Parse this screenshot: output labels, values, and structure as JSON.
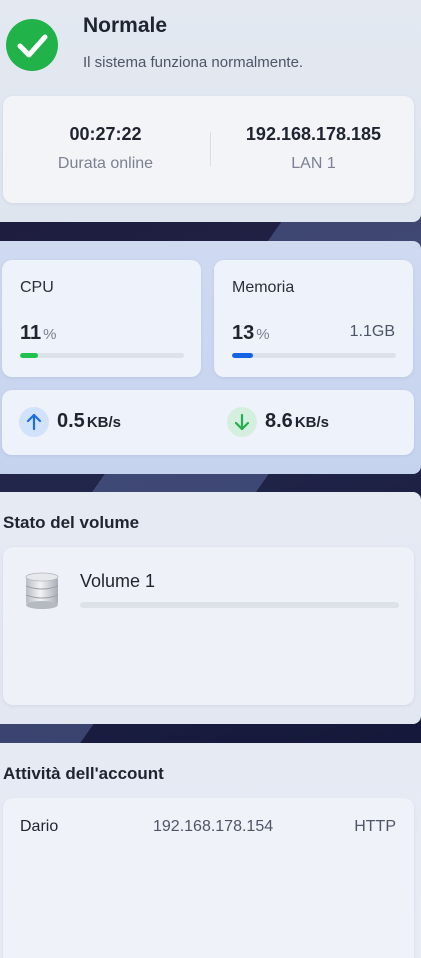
{
  "status": {
    "title": "Normale",
    "subtitle": "Il sistema funziona normalmente.",
    "icon": "check-circle-icon",
    "color": "#21b24a"
  },
  "network": {
    "uptime_value": "00:27:22",
    "uptime_label": "Durata online",
    "ip_value": "192.168.178.185",
    "ip_label": "LAN 1"
  },
  "resources": {
    "cpu": {
      "label": "CPU",
      "value": "11",
      "unit": "%",
      "percent": 11,
      "color": "#1fc24d"
    },
    "memory": {
      "label": "Memoria",
      "value": "13",
      "unit": "%",
      "percent": 13,
      "total": "1.1GB",
      "color": "#1464e6"
    },
    "upload": {
      "value": "0.5",
      "unit": "KB/s",
      "icon": "arrow-up-icon",
      "color": "#1f6ee0"
    },
    "download": {
      "value": "8.6",
      "unit": "KB/s",
      "icon": "arrow-down-icon",
      "color": "#22b04f"
    }
  },
  "volume": {
    "title": "Stato del volume",
    "items": [
      {
        "name": "Volume 1",
        "percent": 0,
        "icon": "database-icon"
      }
    ]
  },
  "accounts": {
    "title": "Attività dell'account",
    "rows": [
      {
        "user": "Dario",
        "ip": "192.168.178.154",
        "protocol": "HTTP"
      }
    ]
  }
}
